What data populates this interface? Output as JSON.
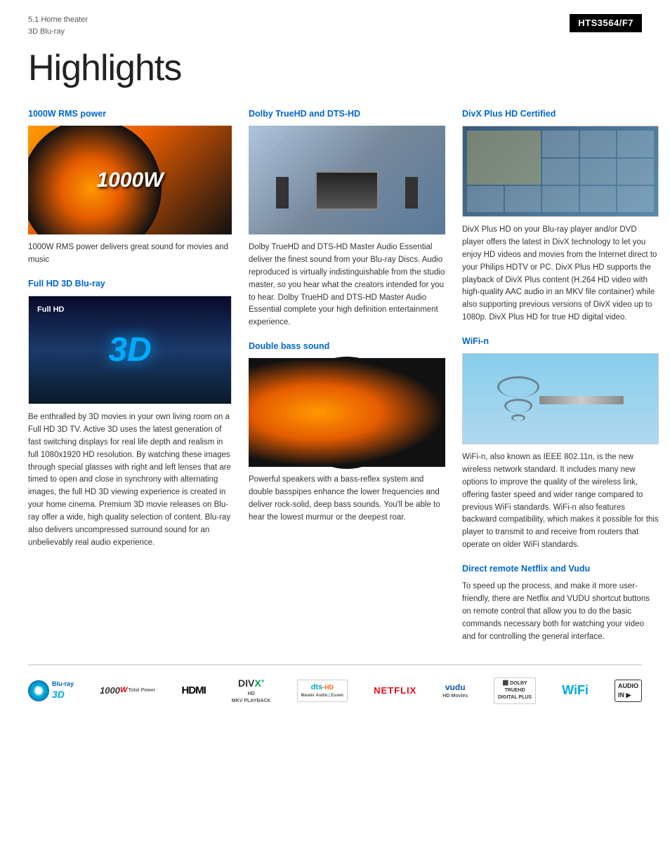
{
  "header": {
    "subtitle_line1": "5.1 Home theater",
    "subtitle_line2": "3D Blu-ray",
    "model": "HTS3564/F7",
    "page_title": "Highlights"
  },
  "col1": {
    "feature1_title": "1000W RMS power",
    "feature1_img_text": "1000W",
    "feature1_desc": "1000W RMS power delivers great sound for movies and music",
    "feature2_title": "Full HD 3D Blu-ray",
    "feature2_desc": "Be enthralled by 3D movies in your own living room on a Full HD 3D TV. Active 3D uses the latest generation of fast switching displays for real life depth and realism in full 1080x1920 HD resolution. By watching these images through special glasses with right and left lenses that are timed to open and close in synchrony with alternating images, the full HD 3D viewing experience is created in your home cinema. Premium 3D movie releases on Blu-ray offer a wide, high quality selection of content. Blu-ray also delivers uncompressed surround sound for an unbelievably real audio experience."
  },
  "col2": {
    "feature1_title": "Dolby TrueHD and DTS-HD",
    "feature1_desc": "Dolby TrueHD and DTS-HD Master Audio Essential deliver the finest sound from your Blu-ray Discs. Audio reproduced is virtually indistinguishable from the studio master, so you hear what the creators intended for you to hear. Dolby TrueHD and DTS-HD Master Audio Essential complete your high definition entertainment experience.",
    "feature2_title": "Double bass sound",
    "feature2_desc": "Powerful speakers with a bass-reflex system and double basspipes enhance the lower frequencies and deliver rock-solid, deep bass sounds. You'll be able to hear the lowest murmur or the deepest roar."
  },
  "col3": {
    "feature1_title": "DivX Plus HD Certified",
    "feature1_desc": "DivX Plus HD on your Blu-ray player and/or DVD player offers the latest in DivX technology to let you enjoy HD videos and movies from the Internet direct to your Philips HDTV or PC. DivX Plus HD supports the playback of DivX Plus content (H.264 HD video with high-quality AAC audio in an MKV file container) while also supporting previous versions of DivX video up to 1080p. DivX Plus HD for true HD digital video.",
    "feature2_title": "WiFi-n",
    "feature2_desc": "WiFi-n, also known as IEEE 802.11n, is the new wireless network standard. It includes many new options to improve the quality of the wireless link, offering faster speed and wider range compared to previous WiFi standards. WiFi-n also features backward compatibility, which makes it possible for this player to transmit to and receive from routers that operate on older WiFi standards.",
    "feature3_title": "Direct remote Netflix and Vudu",
    "feature3_desc": "To speed up the process, and make it more user-friendly, there are Netflix and VUDU shortcut buttons on remote control that allow you to do the basic commands necessary both for watching your video and for controlling the general interface."
  },
  "logos": {
    "bluray": "Blu-ray 3D",
    "power": "1000w",
    "hdmi": "HDMI",
    "divx": "DIVX+ HD MKV PLAYBACK",
    "dts": "dts-HD Master Audio | Essen",
    "netflix": "NETFLIX",
    "vudu": "vudu HD Movies",
    "dolby": "DOLBY TRUEHD DIGITAL PLUS",
    "wifi": "WiFi",
    "audio": "AUDIO IN"
  }
}
